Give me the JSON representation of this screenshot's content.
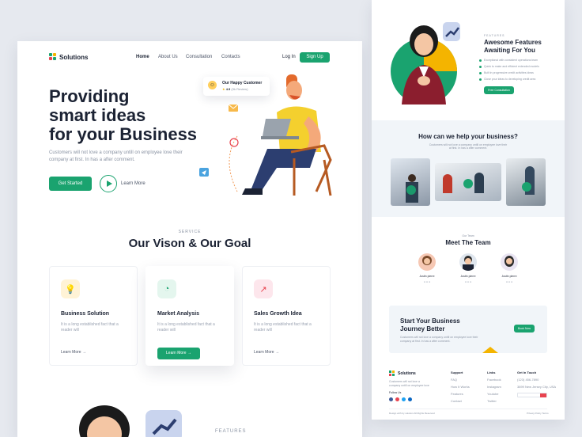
{
  "left": {
    "brand": "Solutions",
    "nav": [
      "Home",
      "About Us",
      "Consultation",
      "Contacts"
    ],
    "login": "Log In",
    "signup": "Sign Up",
    "hero_title_lines": [
      "Providing",
      "smart ideas",
      "for your Business"
    ],
    "hero_text": "Customers will not love a company untill on employee love their company at first. In has a after comment.",
    "get_started": "Get Started",
    "learn_more": "Learn More",
    "review_title": "Our Happy Customer",
    "review_rating": "4.9",
    "review_count": "(9k Review)",
    "service_label": "SERVICE",
    "service_title": "Our Vison & Our Goal",
    "features": [
      {
        "title": "Business Solution",
        "text": "It is a long established fact that a reader will",
        "link": "Learn More →",
        "icon": "lightbulb-icon",
        "bg": "#fff3d6"
      },
      {
        "title": "Market Analysis",
        "text": "It is a long established fact that a reader will",
        "link": "Learn More →",
        "icon": "chart-circle-icon",
        "bg": "#e4f6ee"
      },
      {
        "title": "Sales Growth Idea",
        "text": "It is a long established fact that a reader will",
        "link": "Learn More →",
        "icon": "growth-icon",
        "bg": "#fde6ec"
      }
    ],
    "features_label": "FEATURES"
  },
  "right": {
    "features_label": "FEATURES",
    "features_title_lines": [
      "Awesome Features",
      "Awaiting For You"
    ],
    "bullets": [
      "Exceptional with consistent operations team",
      "Quick to make and efficient extended models",
      "Built in progressive credit activities ideas",
      "Close your ideas to developing credit area"
    ],
    "free_consultation": "Free Consultation",
    "help_title": "How can we help your business?",
    "help_text_lines": [
      "Customers will not love a company untill on employee love their",
      "at first. In has a after comment."
    ],
    "team_label": "Our Team",
    "team_title": "Meet The Team",
    "members": [
      "Justin pierre",
      "Justin pierre",
      "Justin pierre"
    ],
    "cta_title_lines": [
      "Start Your Business",
      "Journey Better"
    ],
    "cta_text": "Customers will not love a company untill on employee love their company at first. In has a after comment.",
    "cta_button": "Book Now",
    "footer": {
      "brand": "Solutions",
      "about": "Customers will not love a company untill on employee love",
      "follow": "Follow Us",
      "cols": [
        {
          "head": "Support",
          "items": [
            "FAQ",
            "How It Works",
            "Features",
            "Contact"
          ]
        },
        {
          "head": "Links",
          "items": [
            "Facebook",
            "Instagram",
            "Youtube",
            "Twitter"
          ]
        },
        {
          "head": "Get In Touch",
          "items": [
            "(123) 456-7890",
            "3899 New Jersey City, USA"
          ]
        }
      ],
      "copyright": "Design with by solution All Rights Reserved",
      "terms": "Privacy Policy Terms"
    }
  }
}
